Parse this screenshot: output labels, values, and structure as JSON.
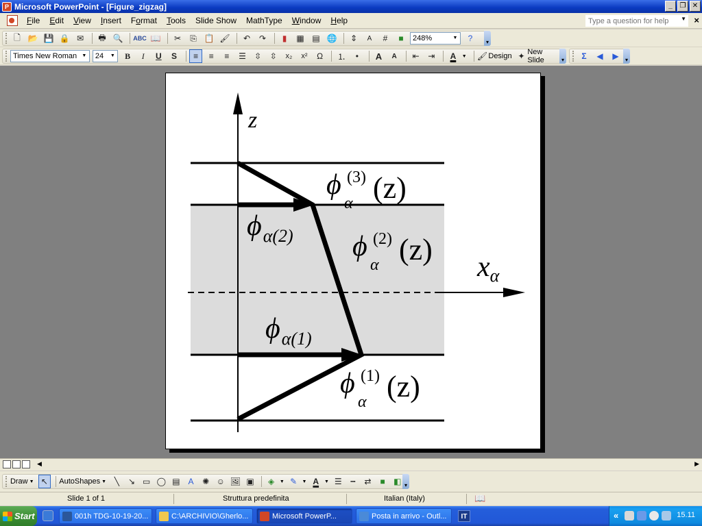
{
  "window": {
    "title": "Microsoft PowerPoint - [Figure_zigzag]"
  },
  "menu": [
    {
      "label": "File",
      "key": "F"
    },
    {
      "label": "Edit",
      "key": "E"
    },
    {
      "label": "View",
      "key": "V"
    },
    {
      "label": "Insert",
      "key": "I"
    },
    {
      "label": "Format",
      "key": "o"
    },
    {
      "label": "Tools",
      "key": "T"
    },
    {
      "label": "Slide Show",
      "key": "D"
    },
    {
      "label": "MathType",
      "key": ""
    },
    {
      "label": "Window",
      "key": "W"
    },
    {
      "label": "Help",
      "key": "H"
    }
  ],
  "help_box": {
    "placeholder": "Type a question for help"
  },
  "standard_toolbar": {
    "zoom": "248%"
  },
  "formatting_toolbar": {
    "font": "Times New Roman",
    "size": "24",
    "bold": "B",
    "italic": "I",
    "underline": "U",
    "shadow": "S",
    "subscript": "x₂",
    "superscript": "x²",
    "symbol": "Ω",
    "grow": "A",
    "shrink": "A",
    "font_color": "A",
    "design_label": "Design",
    "new_slide_label": "New Slide",
    "sigma": "Σ"
  },
  "drawing_toolbar": {
    "draw_label": "Draw",
    "autoshapes_label": "AutoShapes",
    "font_color": "A"
  },
  "status": {
    "slide": "Slide 1 of 1",
    "design": "Struttura predefinita",
    "language": "Italian (Italy)"
  },
  "taskbar": {
    "start": "Start",
    "tasks": [
      {
        "label": "001h TDG-10-19-20...",
        "color": "#2b579a"
      },
      {
        "label": "C:\\ARCHIVIO\\Gherlo...",
        "color": "#f0c850"
      },
      {
        "label": "Microsoft PowerP...",
        "color": "#d24726"
      },
      {
        "label": "Posta in arrivo - Outl...",
        "color": "#4a8ad8"
      }
    ],
    "lang": "IT",
    "tray_chevron": "«",
    "clock": "15.11"
  },
  "slide": {
    "axis_z": "z",
    "axis_x": "x",
    "axis_x_sub": "α",
    "phi": "ϕ",
    "alpha": "α",
    "layer3": {
      "sup": "(3)",
      "arg": "(z)"
    },
    "layer2": {
      "sup": "(2)",
      "arg": "(z)"
    },
    "layer1": {
      "sup": "(1)",
      "arg": "(z)"
    },
    "interface2_sub": "α(2)",
    "interface1_sub": "α(1)"
  }
}
